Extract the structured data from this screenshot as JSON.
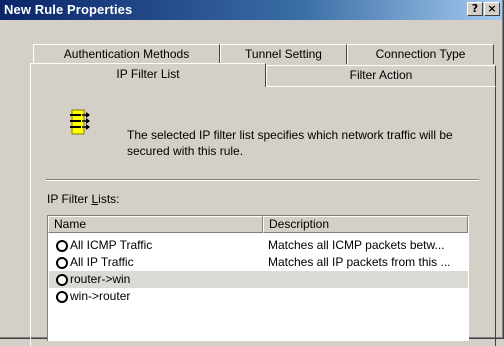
{
  "window": {
    "title": "New Rule Properties",
    "help_label": "?",
    "close_label": "×"
  },
  "tabs": {
    "back": [
      "Authentication Methods",
      "Tunnel Setting",
      "Connection Type"
    ],
    "front": [
      "IP Filter List",
      "Filter Action"
    ],
    "active": "IP Filter List"
  },
  "panel": {
    "description": "The selected IP filter list specifies which network traffic will be secured with this rule.",
    "lists_label_prefix": "IP Filter ",
    "lists_label_accel": "L",
    "lists_label_suffix": "ists:"
  },
  "table": {
    "columns": [
      "Name",
      "Description"
    ],
    "rows": [
      {
        "name": "All ICMP Traffic",
        "description": "Matches all ICMP packets betw...",
        "selected": false
      },
      {
        "name": "All IP Traffic",
        "description": "Matches all IP packets from this ...",
        "selected": false
      },
      {
        "name": "router->win",
        "description": "",
        "selected": true
      },
      {
        "name": "win->router",
        "description": "",
        "selected": false
      }
    ]
  },
  "colors": {
    "title_bar": "#0a246a",
    "icon_yellow": "#ffff00",
    "selected_row": "#dcdad5"
  },
  "icons": {
    "filter_list": "filter-list-icon"
  }
}
